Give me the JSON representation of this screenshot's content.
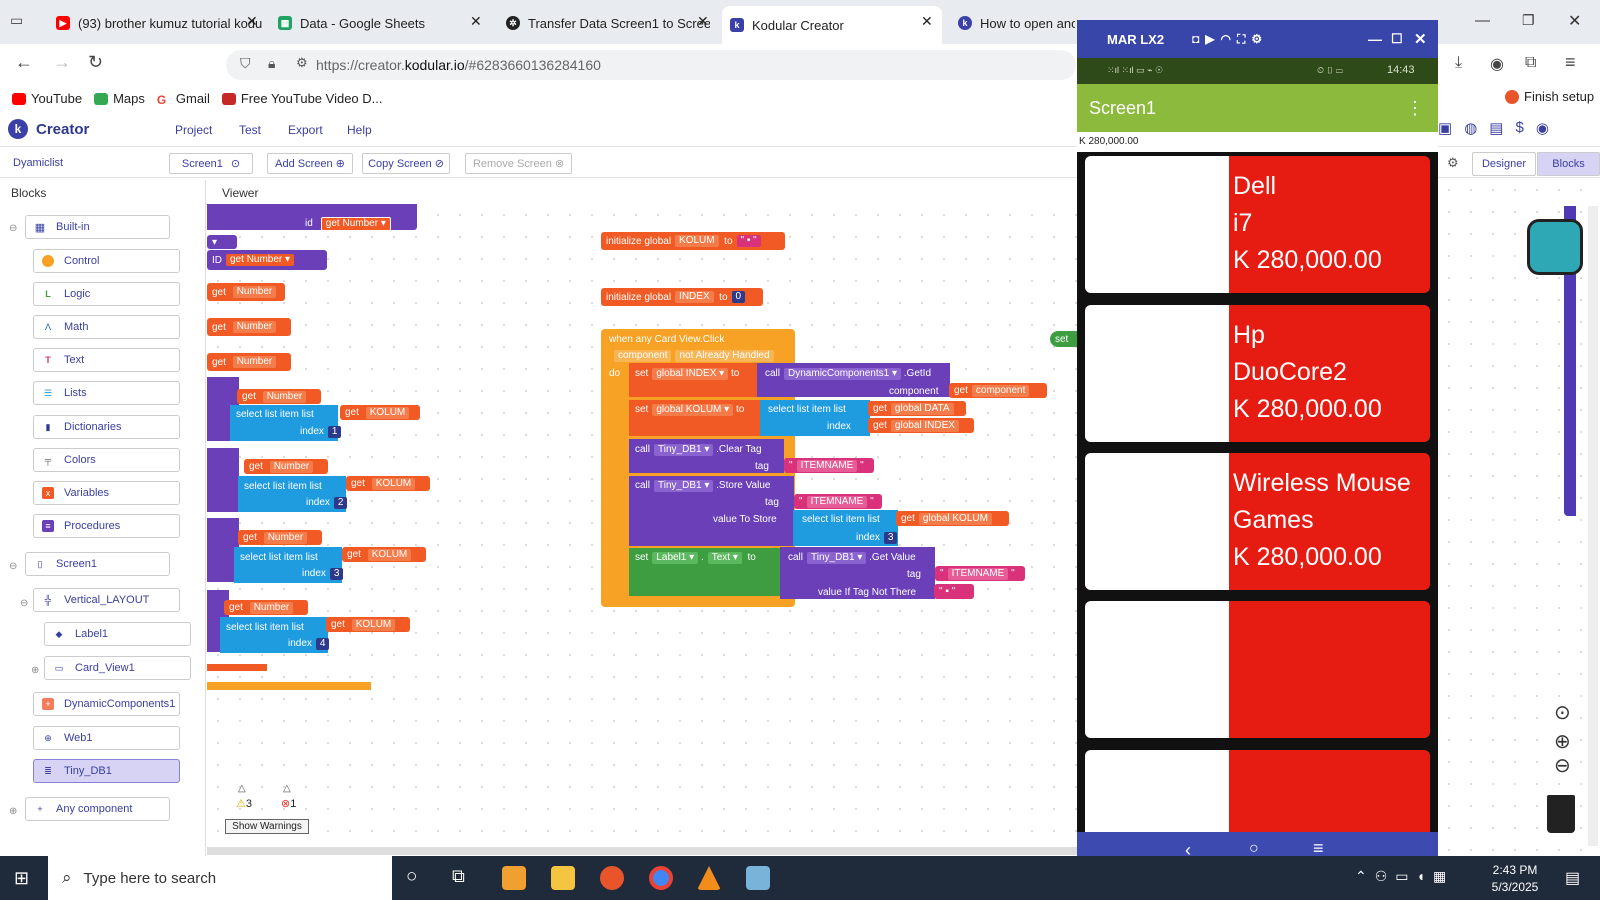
{
  "browser": {
    "tabs": [
      {
        "label": "(93) brother kumuz tutorial kodu",
        "color": "#ff0000"
      },
      {
        "label": "Data - Google Sheets",
        "color": "#1ea362"
      },
      {
        "label": "Transfer Data Screen1 to Screen",
        "color": "#222222"
      },
      {
        "label": "Kodular Creator",
        "color": "#3b3fa8"
      },
      {
        "label": "How to open anoth",
        "color": "#3b3fa8"
      }
    ],
    "url_prefix": "https://creator.",
    "url_domain": "kodular.io",
    "url_suffix": "/#6283660136284160",
    "bookmarks": [
      "YouTube",
      "Maps",
      "Gmail",
      "Free YouTube Video D..."
    ],
    "finish_setup": "Finish setup"
  },
  "kodular": {
    "logo": "Creator",
    "menu": [
      "Project",
      "Test",
      "Export",
      "Help"
    ],
    "project": "Dyamiclist",
    "screen_button": "Screen1",
    "add_screen": "Add Screen",
    "copy_screen": "Copy Screen",
    "remove_screen": "Remove Screen",
    "designer": "Designer",
    "blocks_tab": "Blocks",
    "blocks_header": "Blocks",
    "viewer_header": "Viewer",
    "builtin": [
      "Built-in",
      "Control",
      "Logic",
      "Math",
      "Text",
      "Lists",
      "Dictionaries",
      "Colors",
      "Variables",
      "Procedures"
    ],
    "components": [
      "Screen1",
      "Vertical_LAYOUT",
      "Label1",
      "Card_View1",
      "DynamicComponents1",
      "Web1",
      "Tiny_DB1",
      "Any component"
    ],
    "warnings_count": "3",
    "errors_count": "1",
    "show_warnings": "Show Warnings"
  },
  "blocks": {
    "init_kolum": "initialize global",
    "kolum": "KOLUM",
    "to": "to",
    "index": "INDEX",
    "zero": "0",
    "when": "when any Card View.Click",
    "component": "component",
    "not_handled": "not Already Handled",
    "do": "do",
    "set": "set",
    "global_index": "global INDEX",
    "call": "call",
    "dyncomp": "DynamicComponents1",
    "getid": ".GetId",
    "get": "get",
    "global_kolum": "global KOLUM",
    "select": "select list item",
    "list": "list",
    "global_data": "global DATA",
    "idx": "index",
    "tinydb": "Tiny_DB1",
    "cleartag": ".Clear Tag",
    "tag": "tag",
    "itemname": "ITEMNAME",
    "storevalue": ".Store Value",
    "value_to_store": "value To Store",
    "three": "3",
    "label1": "Label1",
    "text": "Text",
    "getvalue": ".Get Value",
    "if_not_there": "value If Tag Not There",
    "id": "id",
    "number": "Number",
    "left_id": "ID",
    "one": "1",
    "two": "2",
    "four": "4"
  },
  "phone": {
    "device": "MAR LX2",
    "time": "14:43",
    "app_title": "Screen1",
    "label": "K 280,000.00",
    "cards": [
      {
        "lines": [
          "Dell",
          "i7",
          "K 280,000.00"
        ]
      },
      {
        "lines": [
          "Hp",
          "DuoCore2",
          "K 280,000.00"
        ]
      },
      {
        "lines": [
          "Wireless Mouse",
          "Games",
          "K 280,000.00"
        ]
      },
      {
        "lines": []
      },
      {
        "lines": []
      }
    ]
  },
  "taskbar": {
    "search": "Type here to search",
    "time": "2:43 PM",
    "date": "5/3/2025"
  }
}
